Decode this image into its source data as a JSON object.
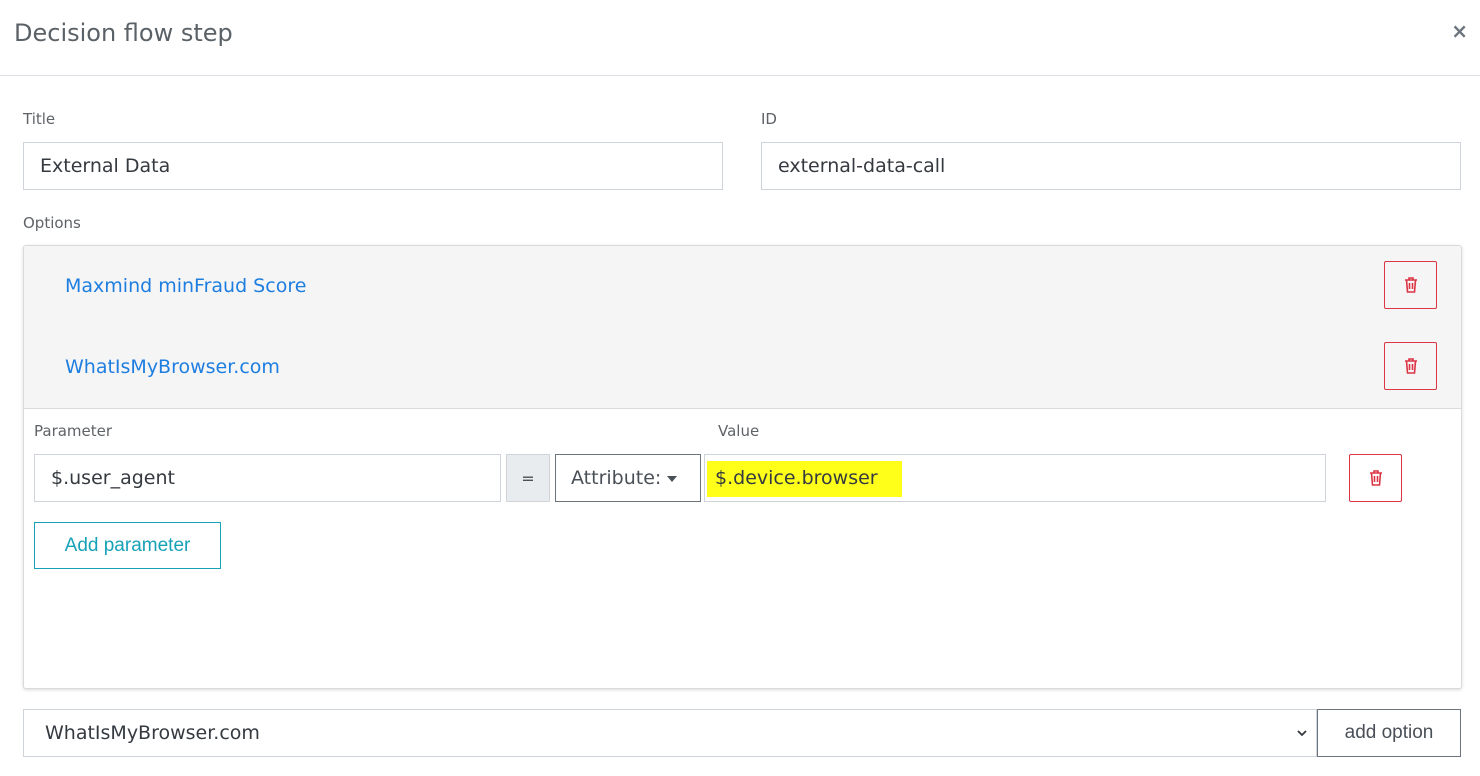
{
  "modal": {
    "title": "Decision flow step",
    "close_symbol": "×"
  },
  "form": {
    "title_label": "Title",
    "title_value": "External Data",
    "id_label": "ID",
    "id_value": "external-data-call",
    "options_label": "Options"
  },
  "options": [
    {
      "label": "Maxmind minFraud Score"
    },
    {
      "label": "WhatIsMyBrowser.com"
    }
  ],
  "parameters": {
    "parameter_label": "Parameter",
    "value_label": "Value",
    "rows": [
      {
        "parameter": "$.user_agent",
        "operator": "=",
        "type": "Attribute:",
        "value": "$.device.browser"
      }
    ],
    "add_button": "Add parameter"
  },
  "footer": {
    "selected_option": "WhatIsMyBrowser.com",
    "add_option_button": "add option"
  },
  "colors": {
    "link": "#1e7ee0",
    "danger": "#dc3545",
    "info": "#17a2b8",
    "highlight": "#ffff1a"
  },
  "icons": {
    "delete": "trash-icon",
    "close": "close-icon",
    "dropdown": "chevron-down-icon"
  }
}
